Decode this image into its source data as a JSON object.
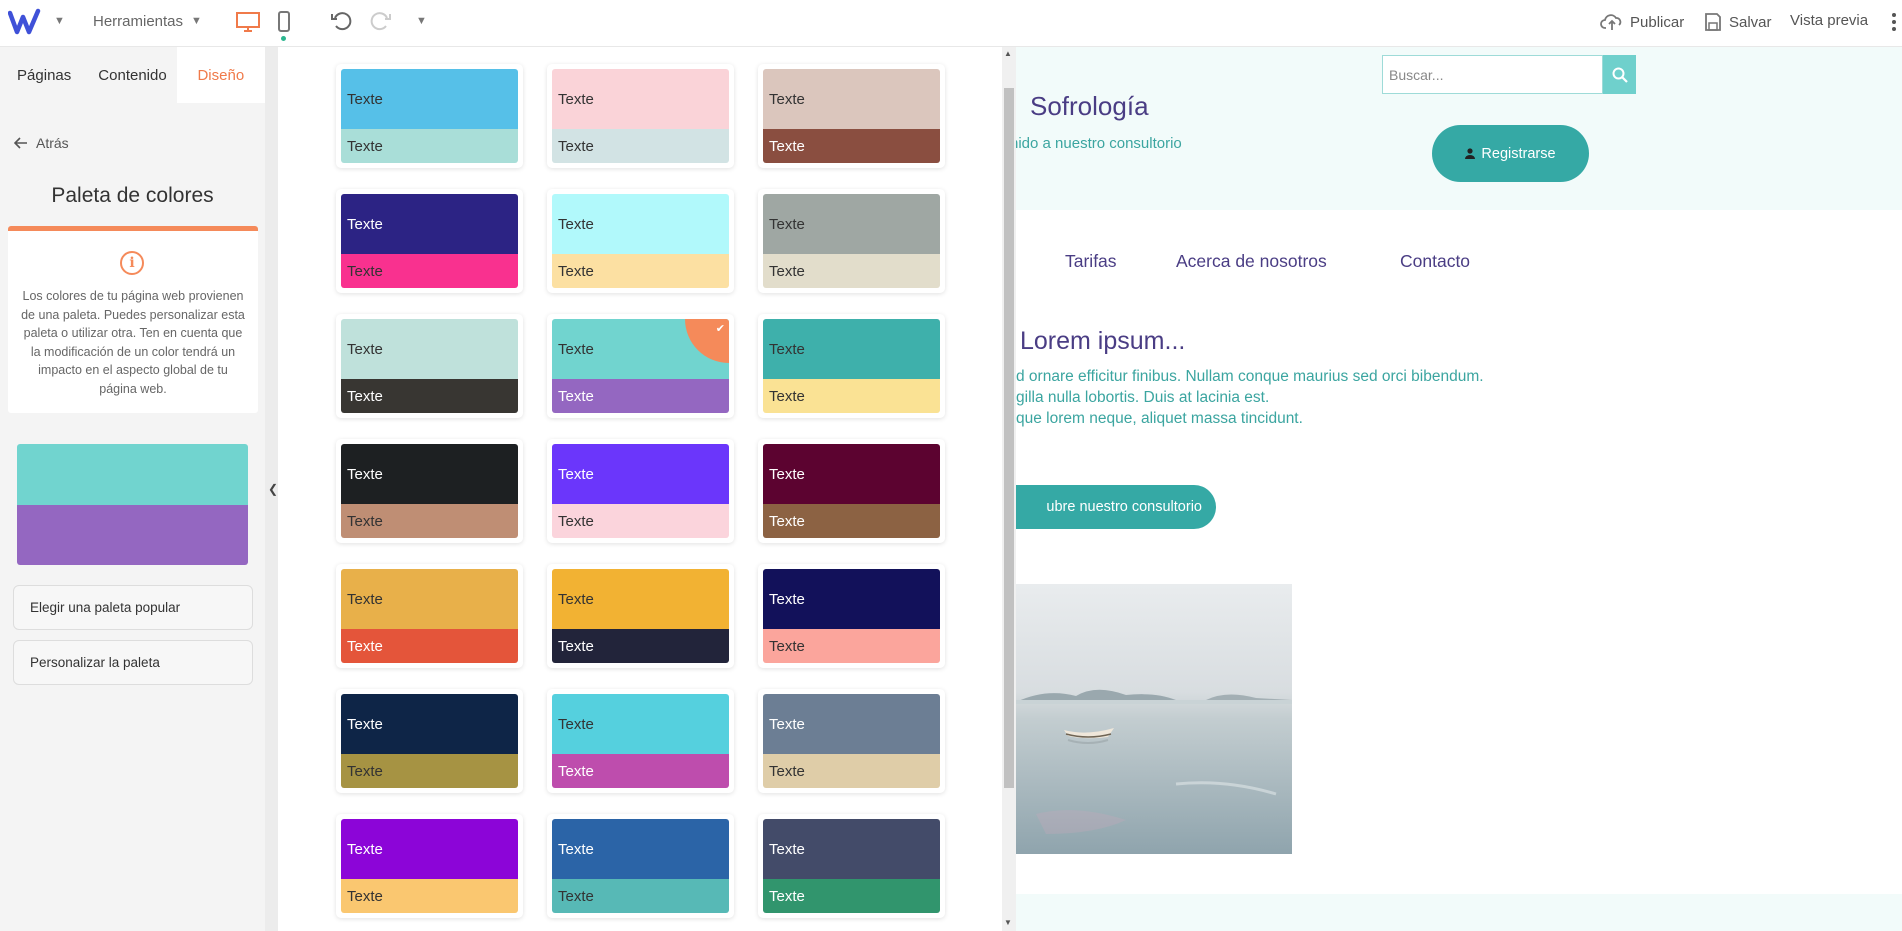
{
  "toolbar": {
    "tools_label": "Herramientas",
    "publish": "Publicar",
    "save": "Salvar",
    "preview": "Vista previa"
  },
  "left_panel": {
    "tabs": [
      {
        "label": "Páginas",
        "active": false
      },
      {
        "label": "Contenido",
        "active": false
      },
      {
        "label": "Diseño",
        "active": true
      }
    ],
    "back": "Atrás",
    "title": "Paleta de colores",
    "info": "Los colores de tu página web provienen de una paleta. Puedes personalizar esta paleta o utilizar otra. Ten en cuenta que la modificación de un color tendrá un impacto en el aspecto global de tu página web.",
    "current_palette": {
      "primary": "#71d4cf",
      "secondary": "#9467c1"
    },
    "buttons": {
      "popular": "Elegir una paleta popular",
      "customize": "Personalizar la paleta"
    }
  },
  "palettes": {
    "label": "Texte",
    "items": [
      {
        "top": "#56c0e8",
        "bottom": "#a9ded8",
        "top_text": "#333333",
        "bottom_text": "#333333"
      },
      {
        "top": "#fad3d8",
        "bottom": "#d2e3e4",
        "top_text": "#333333",
        "bottom_text": "#333333"
      },
      {
        "top": "#dbc6bd",
        "bottom": "#8a4e40",
        "top_text": "#333333",
        "bottom_text": "#ffffff"
      },
      {
        "top": "#2c2384",
        "bottom": "#f9318f",
        "top_text": "#ffffff",
        "bottom_text": "#333333"
      },
      {
        "top": "#b1f9fb",
        "bottom": "#fce0a2",
        "top_text": "#333333",
        "bottom_text": "#333333"
      },
      {
        "top": "#9fa7a3",
        "bottom": "#e2ddcb",
        "top_text": "#333333",
        "bottom_text": "#333333"
      },
      {
        "top": "#bfe1db",
        "bottom": "#383632",
        "top_text": "#333333",
        "bottom_text": "#ffffff"
      },
      {
        "top": "#71d4cf",
        "bottom": "#9467c1",
        "top_text": "#333333",
        "bottom_text": "#ffffff",
        "selected": true
      },
      {
        "top": "#3eb0ab",
        "bottom": "#fae294",
        "top_text": "#333333",
        "bottom_text": "#333333"
      },
      {
        "top": "#1d2022",
        "bottom": "#bf8e74",
        "top_text": "#ffffff",
        "bottom_text": "#333333"
      },
      {
        "top": "#6b36fb",
        "bottom": "#fbd4dc",
        "top_text": "#ffffff",
        "bottom_text": "#333333"
      },
      {
        "top": "#5c0330",
        "bottom": "#8c6243",
        "top_text": "#ffffff",
        "bottom_text": "#ffffff"
      },
      {
        "top": "#e8b04a",
        "bottom": "#e4553a",
        "top_text": "#333333",
        "bottom_text": "#ffffff"
      },
      {
        "top": "#f2b233",
        "bottom": "#22243a",
        "top_text": "#333333",
        "bottom_text": "#ffffff"
      },
      {
        "top": "#12115a",
        "bottom": "#fba59c",
        "top_text": "#ffffff",
        "bottom_text": "#333333"
      },
      {
        "top": "#0e2547",
        "bottom": "#a69343",
        "top_text": "#ffffff",
        "bottom_text": "#333333"
      },
      {
        "top": "#55d0de",
        "bottom": "#be4dad",
        "top_text": "#333333",
        "bottom_text": "#ffffff"
      },
      {
        "top": "#6c7e94",
        "bottom": "#dfcda8",
        "top_text": "#ffffff",
        "bottom_text": "#333333"
      },
      {
        "top": "#8c05d8",
        "bottom": "#fac770",
        "top_text": "#ffffff",
        "bottom_text": "#333333"
      },
      {
        "top": "#2b64a7",
        "bottom": "#57b9b6",
        "top_text": "#ffffff",
        "bottom_text": "#333333"
      },
      {
        "top": "#434b69",
        "bottom": "#31956d",
        "top_text": "#ffffff",
        "bottom_text": "#ffffff"
      }
    ]
  },
  "site": {
    "title": "Sofrología",
    "subtitle": "nido a nuestro consultorio",
    "search_placeholder": "Buscar...",
    "register": "Registrarse",
    "nav": [
      "Tarifas",
      "Acerca de nosotros",
      "Contacto"
    ],
    "heading": "Lorem ipsum...",
    "lines": [
      "d ornare efficitur finibus. Nullam conque maurius sed orci bibendum.",
      "gilla nulla lobortis. Duis at lacinia est.",
      "que lorem neque, aliquet massa tincidunt."
    ],
    "cta": "ubre nuestro consultorio"
  }
}
